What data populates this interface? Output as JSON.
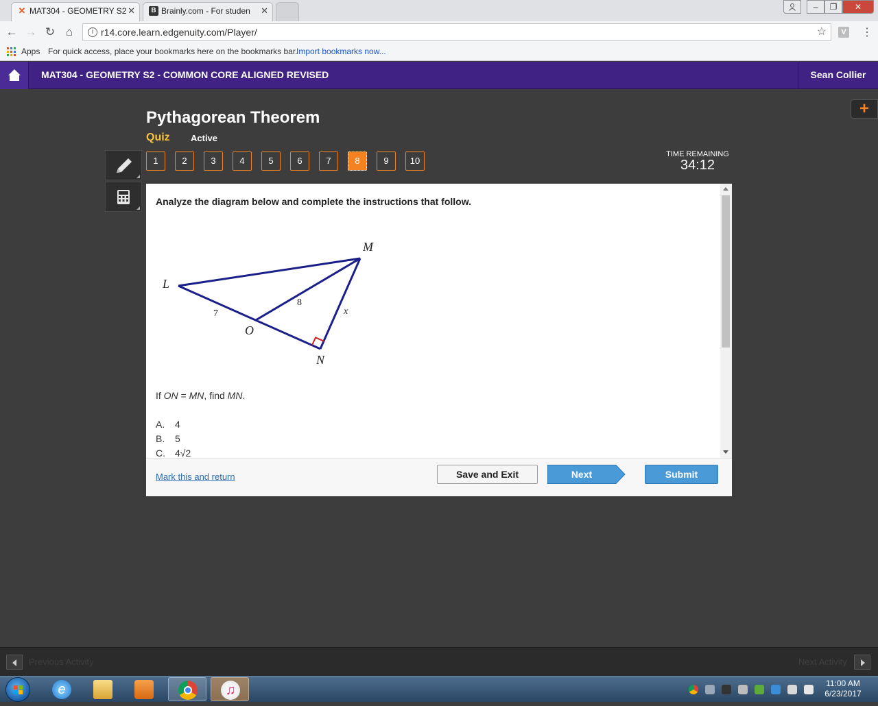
{
  "browser": {
    "tabs": [
      {
        "title": "MAT304 - GEOMETRY S2",
        "active": true
      },
      {
        "title": "Brainly.com - For studen",
        "active": false
      }
    ],
    "url": "r14.core.learn.edgenuity.com/Player/",
    "bookmarks_apps": "Apps",
    "bookmarks_hint": "For quick access, place your bookmarks here on the bookmarks bar.",
    "bookmarks_import": "Import bookmarks now...",
    "ext_label": "V"
  },
  "site": {
    "course_title": "MAT304 - GEOMETRY S2 - COMMON CORE ALIGNED REVISED",
    "user_name": "Sean Collier",
    "plus": "+"
  },
  "lesson": {
    "title": "Pythagorean Theorem",
    "type": "Quiz",
    "status": "Active",
    "questions": [
      "1",
      "2",
      "3",
      "4",
      "5",
      "6",
      "7",
      "8",
      "9",
      "10"
    ],
    "current_question": "8",
    "time_label": "TIME REMAINING",
    "time_value": "34:12"
  },
  "question": {
    "instructions": "Analyze the diagram below and complete the instructions that follow.",
    "prompt_parts": [
      "If ",
      "ON",
      " = ",
      "MN",
      ", find ",
      "MN",
      "."
    ],
    "diagram": {
      "vertex_labels": {
        "L": "L",
        "M": "M",
        "O": "O",
        "N": "N"
      },
      "side_labels": {
        "LO": "7",
        "OM": "8",
        "MN": "x"
      }
    },
    "choices": [
      {
        "letter": "A.",
        "text": "4"
      },
      {
        "letter": "B.",
        "text": "5"
      },
      {
        "letter": "C.",
        "text": "4√2"
      }
    ]
  },
  "footer": {
    "mark_link": "Mark this and return",
    "save_exit": "Save and Exit",
    "next": "Next",
    "submit": "Submit"
  },
  "activity_nav": {
    "previous": "Previous Activity",
    "next": "Next Activity"
  },
  "taskbar": {
    "time": "11:00 AM",
    "date": "6/23/2017"
  },
  "colors": {
    "header_purple": "#3f2283",
    "accent_orange": "#f58220",
    "quiz_yellow": "#f6c244",
    "button_blue": "#4a9ad8",
    "triangle_navy": "#1b1f8a",
    "right_angle_red": "#d42020"
  }
}
